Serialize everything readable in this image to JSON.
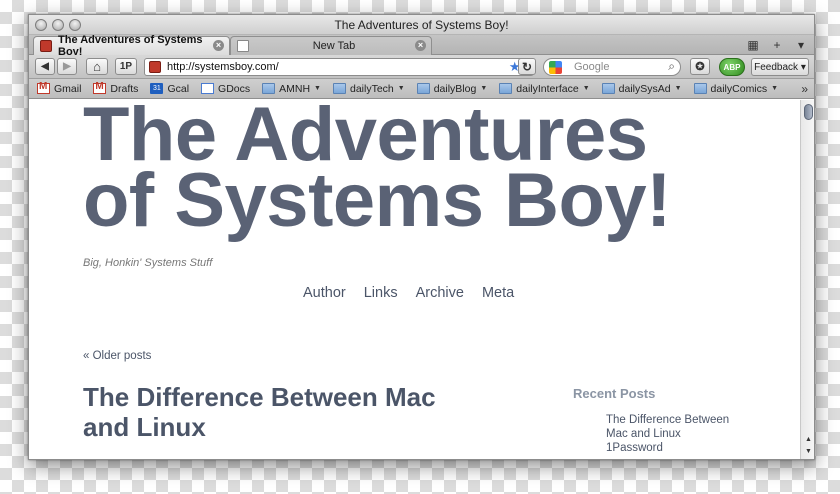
{
  "window": {
    "title": "The Adventures of Systems Boy!"
  },
  "tabs": [
    {
      "label": "The Adventures of Systems Boy!",
      "active": true
    },
    {
      "label": "New Tab",
      "active": false
    }
  ],
  "navbar": {
    "back": "◀",
    "forward": "▶",
    "home": "⌂",
    "onepassword": "1P",
    "url": "http://systemsboy.com/",
    "reload": "↻",
    "search_placeholder": "Google",
    "abp_label": "ABP",
    "feedback_label": "Feedback ▾"
  },
  "bookmarks": [
    {
      "label": "Gmail",
      "icon": "gmail-icon"
    },
    {
      "label": "Drafts",
      "icon": "gmail-icon"
    },
    {
      "label": "Gcal",
      "icon": "calendar-icon",
      "icon_text": "31"
    },
    {
      "label": "GDocs",
      "icon": "docs-icon"
    },
    {
      "label": "AMNH",
      "icon": "folder-icon",
      "menu": true
    },
    {
      "label": "dailyTech",
      "icon": "folder-icon",
      "menu": true
    },
    {
      "label": "dailyBlog",
      "icon": "folder-icon",
      "menu": true
    },
    {
      "label": "dailyInterface",
      "icon": "folder-icon",
      "menu": true
    },
    {
      "label": "dailySysAd",
      "icon": "folder-icon",
      "menu": true
    },
    {
      "label": "dailyComics",
      "icon": "folder-icon",
      "menu": true
    }
  ],
  "page": {
    "site_title_line1": "The Adventures",
    "site_title_line2": "of Systems Boy!",
    "tagline": "Big, Honkin' Systems Stuff",
    "nav": [
      "Author",
      "Links",
      "Archive",
      "Meta"
    ],
    "older_posts": "« Older posts",
    "post_title_line1": "The Difference Between Mac",
    "post_title_line2": "and Linux",
    "recent_posts_heading": "Recent Posts",
    "recent_posts": [
      "The Difference Between",
      "Mac and Linux",
      "1Password"
    ]
  },
  "colors": {
    "title": "#5a6275",
    "link": "#4b5568",
    "recent_heading": "#8b95a4"
  }
}
